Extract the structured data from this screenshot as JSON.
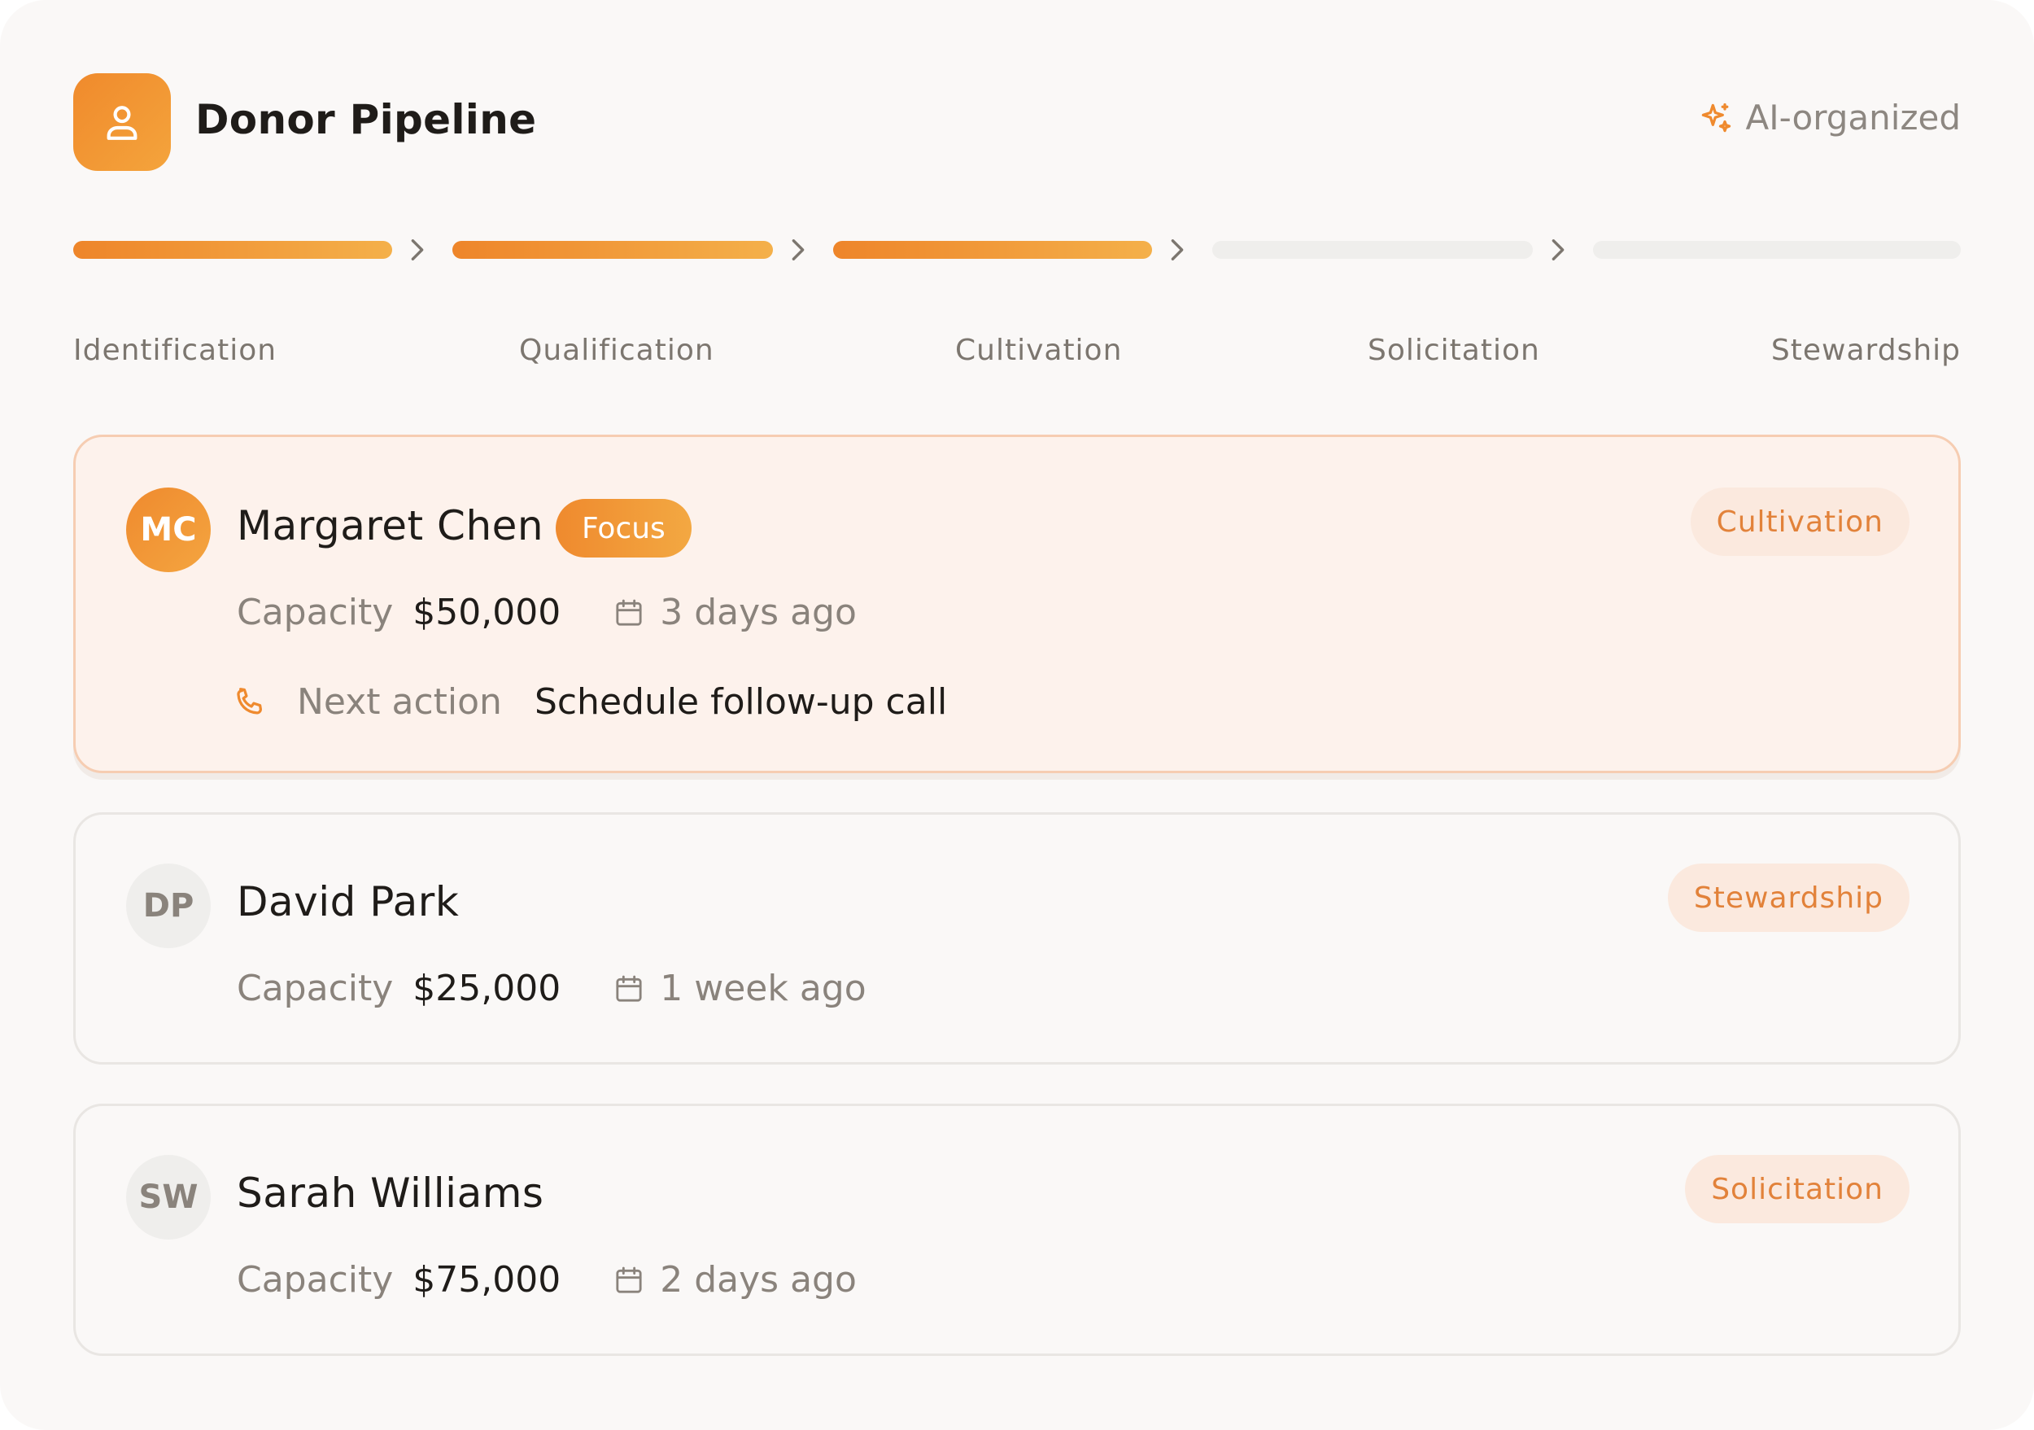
{
  "header": {
    "title": "Donor Pipeline",
    "app_icon": "user-icon",
    "ai_tag": "AI-organized",
    "ai_icon": "sparkle-icon"
  },
  "stages": [
    {
      "label": "Identification",
      "complete": true
    },
    {
      "label": "Qualification",
      "complete": true
    },
    {
      "label": "Cultivation",
      "complete": true
    },
    {
      "label": "Solicitation",
      "complete": false
    },
    {
      "label": "Stewardship",
      "complete": false
    }
  ],
  "donors": [
    {
      "initials": "MC",
      "name": "Margaret Chen",
      "badge": "Focus",
      "stage": "Cultivation",
      "capacity_label": "Capacity",
      "capacity": "$50,000",
      "last_contact": "3 days ago",
      "next_action_label": "Next action",
      "next_action": "Schedule follow-up call"
    },
    {
      "initials": "DP",
      "name": "David Park",
      "stage": "Stewardship",
      "capacity_label": "Capacity",
      "capacity": "$25,000",
      "last_contact": "1 week ago"
    },
    {
      "initials": "SW",
      "name": "Sarah Williams",
      "stage": "Solicitation",
      "capacity_label": "Capacity",
      "capacity": "$75,000",
      "last_contact": "2 days ago"
    }
  ],
  "colors": {
    "accent": "#ef8a2e",
    "accent_light": "#f4b04a",
    "badge_bg": "#fbe9de",
    "focus_card_bg": "#fdf2ec",
    "focus_card_border": "#f6cdb2",
    "track_empty": "#efeeec"
  }
}
